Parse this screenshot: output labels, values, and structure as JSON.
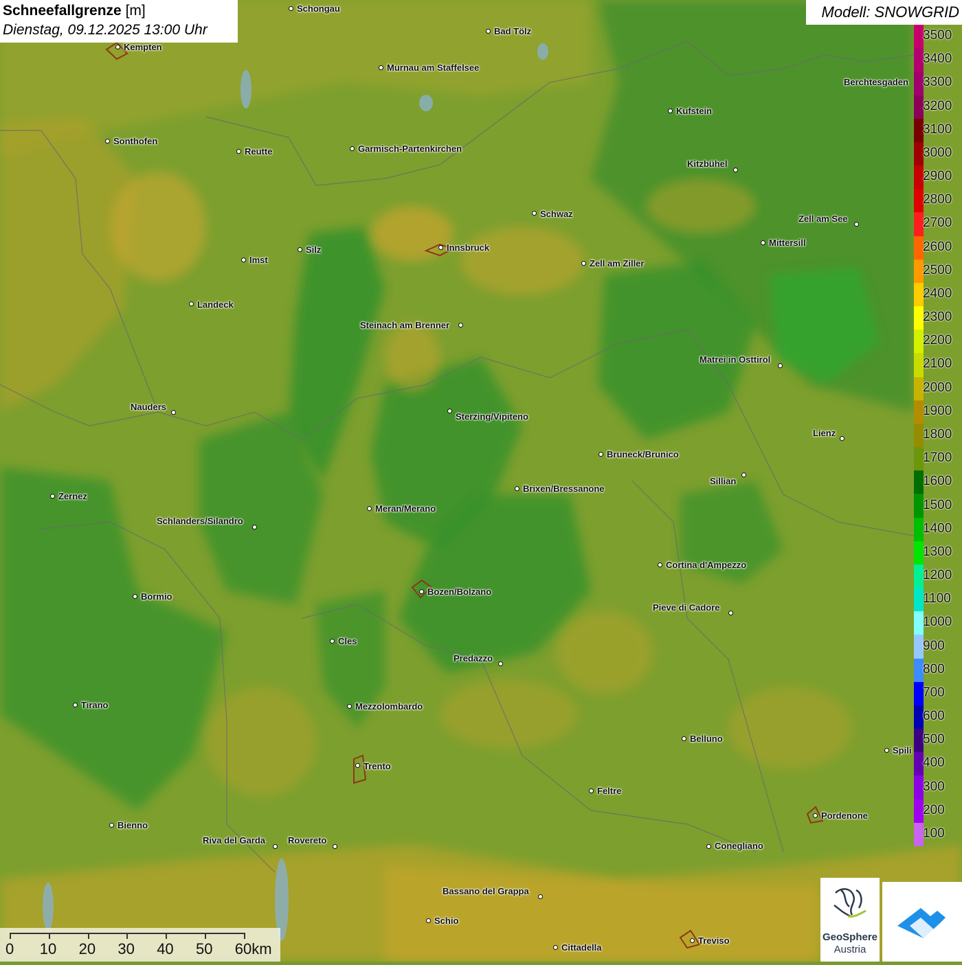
{
  "title": {
    "main": "Schneefallgrenze",
    "unit": "[m]",
    "datetime": "Dienstag, 09.12.2025 13:00 Uhr"
  },
  "model": "Modell: SNOWGRID",
  "legend": {
    "labels": [
      "3500",
      "3400",
      "3300",
      "3200",
      "3100",
      "3000",
      "2900",
      "2800",
      "2700",
      "2600",
      "2500",
      "2400",
      "2300",
      "2200",
      "2100",
      "2000",
      "1900",
      "1800",
      "1700",
      "1600",
      "1500",
      "1400",
      "1300",
      "1200",
      "1100",
      "1000",
      "900",
      "800",
      "700",
      "600",
      "500",
      "400",
      "300",
      "200",
      "100"
    ],
    "colors": [
      "#c8006e",
      "#b4006e",
      "#a0006e",
      "#8c005a",
      "#780000",
      "#a00000",
      "#c80000",
      "#e00000",
      "#ff1e1e",
      "#ff6600",
      "#ff9900",
      "#ffcc00",
      "#ffff00",
      "#d2f000",
      "#c8dc00",
      "#c8b400",
      "#b48c00",
      "#968c00",
      "#6e960a",
      "#006e00",
      "#009600",
      "#00be00",
      "#00e600",
      "#00f096",
      "#00e6c8",
      "#82ffff",
      "#96c8ff",
      "#3c8cff",
      "#0000ff",
      "#0000b4",
      "#3c0082",
      "#6400b4",
      "#8c00e6",
      "#a000f0",
      "#c864f0"
    ]
  },
  "cities": [
    {
      "name": "Schongau"
    },
    {
      "name": "Bad Tölz"
    },
    {
      "name": "Kempten"
    },
    {
      "name": "Murnau am Staffelsee"
    },
    {
      "name": "Berchtesgaden"
    },
    {
      "name": "Kufstein"
    },
    {
      "name": "Sonthofen"
    },
    {
      "name": "Reutte"
    },
    {
      "name": "Garmisch-Partenkirchen"
    },
    {
      "name": "Kitzbühel"
    },
    {
      "name": "Schwaz"
    },
    {
      "name": "Zell am See"
    },
    {
      "name": "Innsbruck"
    },
    {
      "name": "Mittersill"
    },
    {
      "name": "Silz"
    },
    {
      "name": "Imst"
    },
    {
      "name": "Zell am Ziller"
    },
    {
      "name": "Landeck"
    },
    {
      "name": "Steinach am Brenner"
    },
    {
      "name": "Matrei in Osttirol"
    },
    {
      "name": "Nauders"
    },
    {
      "name": "Sterzing/Vipiteno"
    },
    {
      "name": "Lienz"
    },
    {
      "name": "Bruneck/Brunico"
    },
    {
      "name": "Sillian"
    },
    {
      "name": "Brixen/Bressanone"
    },
    {
      "name": "Zernez"
    },
    {
      "name": "Meran/Merano"
    },
    {
      "name": "Schlanders/Silandro"
    },
    {
      "name": "Cortina d'Ampezzo"
    },
    {
      "name": "Bozen/Bolzano"
    },
    {
      "name": "Bormio"
    },
    {
      "name": "Pieve di Cadore"
    },
    {
      "name": "Cles"
    },
    {
      "name": "Predazzo"
    },
    {
      "name": "Tirano"
    },
    {
      "name": "Mezzolombardo"
    },
    {
      "name": "Belluno"
    },
    {
      "name": "Spili"
    },
    {
      "name": "Trento"
    },
    {
      "name": "Feltre"
    },
    {
      "name": "Pordenone"
    },
    {
      "name": "Bienno"
    },
    {
      "name": "Riva del Garda"
    },
    {
      "name": "Rovereto"
    },
    {
      "name": "Conegliano"
    },
    {
      "name": "Bassano del Grappa"
    },
    {
      "name": "Schio"
    },
    {
      "name": "Treviso"
    },
    {
      "name": "Cittadella"
    }
  ],
  "scale": {
    "labels": [
      "0",
      "10",
      "20",
      "30",
      "40",
      "50",
      "60km"
    ]
  },
  "logos": {
    "geosphere_line1": "GeoSphere",
    "geosphere_line2": "Austria"
  }
}
